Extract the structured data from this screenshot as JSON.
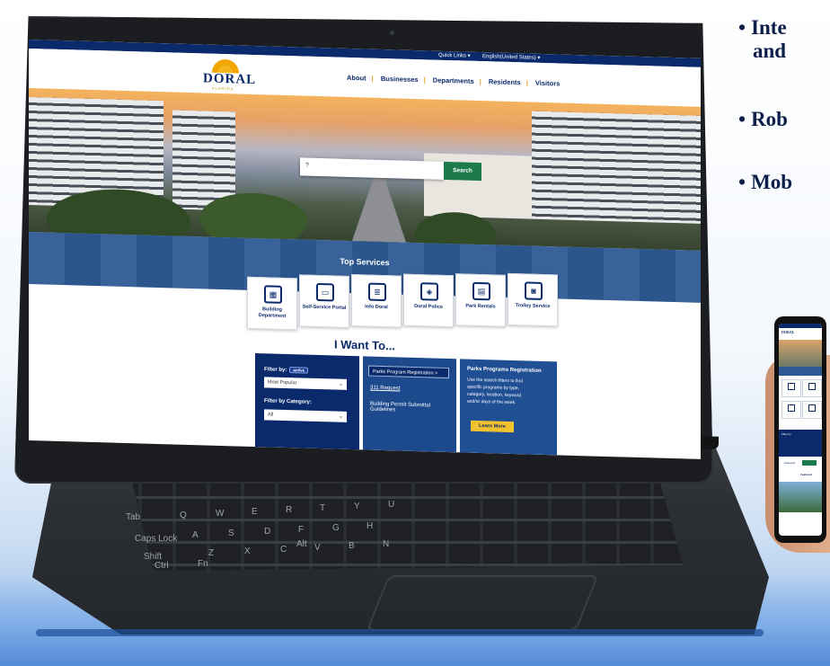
{
  "slide_bullets": [
    "Inte",
    "and",
    "Rob",
    "Mob"
  ],
  "site": {
    "topbar": {
      "quick_links": "Quick Links ▾",
      "language": "English(United States) ▾"
    },
    "logo": {
      "word": "DORAL",
      "sub": "FLORIDA"
    },
    "nav": [
      "About",
      "Businesses",
      "Departments",
      "Residents",
      "Visitors"
    ],
    "search": {
      "value": "?",
      "button": "Search"
    },
    "top_services": {
      "title": "Top Services",
      "items": [
        {
          "label": "Building Department",
          "icon": "building-icon"
        },
        {
          "label": "Self-Service Portal",
          "icon": "monitor-icon"
        },
        {
          "label": "Info Doral",
          "icon": "document-icon"
        },
        {
          "label": "Doral Police",
          "icon": "police-badge-icon"
        },
        {
          "label": "Park Rentals",
          "icon": "calendar-icon"
        },
        {
          "label": "Trolley Service",
          "icon": "trolley-icon"
        }
      ]
    },
    "i_want_to": {
      "title": "I Want To...",
      "filter_by": "Filter by:",
      "filter_badge": "active",
      "filter_value": "Most Popular",
      "category_label": "Filter by Category:",
      "category_value": "All",
      "links": [
        "Parks Program Registration  >",
        "311 Request",
        "Building Permit Submittal Guidelines"
      ],
      "detail_title": "Parks Programs Registration",
      "detail_lines": [
        "Use the search filters to find",
        "specific programs by type,",
        "category, location, keyword",
        "and/or days of the week."
      ],
      "cta": "Learn More"
    }
  },
  "keyboard_labels": [
    "Tab",
    "Caps Lock",
    "Shift",
    "Ctrl",
    "Fn",
    "Alt",
    "Q",
    "W",
    "E",
    "R",
    "T",
    "Y",
    "U",
    "A",
    "S",
    "D",
    "F",
    "G",
    "H",
    "Z",
    "X",
    "C",
    "V",
    "B",
    "N"
  ],
  "phone": {
    "logo": "DORAL",
    "filter_label": "Filter by:",
    "tab_a": "Featured",
    "featured_title": "Featured"
  },
  "colors": {
    "navy": "#0b2a6b",
    "gold": "#f2c12e",
    "green": "#1d7a4a",
    "band_blue": "#2d5a94"
  }
}
